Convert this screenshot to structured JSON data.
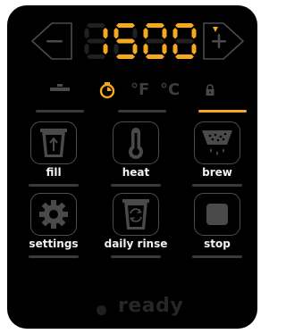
{
  "display": {
    "value": "1500",
    "cursor_digit": 2
  },
  "controls": {
    "decrement_symbol": "−",
    "increment_symbol": "+"
  },
  "status": {
    "unit_f": "°F",
    "unit_c": "°C",
    "active_mode": "timer",
    "icons": [
      "plate-icon",
      "timer-icon",
      "lock-icon"
    ]
  },
  "functions": [
    {
      "label": "fill",
      "icon": "fill-icon"
    },
    {
      "label": "heat",
      "icon": "thermometer-icon"
    },
    {
      "label": "brew",
      "icon": "brew-icon"
    },
    {
      "label": "settings",
      "icon": "gear-icon"
    },
    {
      "label": "daily rinse",
      "icon": "rinse-icon"
    },
    {
      "label": "stop",
      "icon": "stop-icon"
    }
  ],
  "ready": {
    "label": "ready"
  },
  "colors": {
    "accent": "#f6a821",
    "panel": "#000000",
    "muted": "#3a3a3a",
    "label": "#f2f2f2"
  }
}
